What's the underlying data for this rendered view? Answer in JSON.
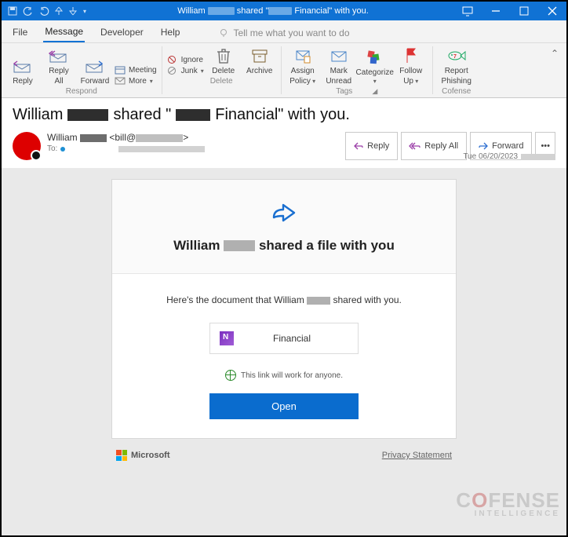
{
  "window": {
    "title_prefix": "William ",
    "title_mid": " shared \"",
    "title_suffix": " Financial\" with you."
  },
  "tabs": {
    "file": "File",
    "message": "Message",
    "developer": "Developer",
    "help": "Help",
    "tell": "Tell me what you want to do"
  },
  "ribbon": {
    "reply": "Reply",
    "reply_all_l1": "Reply",
    "reply_all_l2": "All",
    "forward": "Forward",
    "meeting": "Meeting",
    "more": "More",
    "respond_group": "Respond",
    "ignore": "Ignore",
    "junk": "Junk",
    "delete": "Delete",
    "archive": "Archive",
    "delete_group": "Delete",
    "assign_l1": "Assign",
    "assign_l2": "Policy",
    "mark_l1": "Mark",
    "mark_l2": "Unread",
    "categorize": "Categorize",
    "follow_l1": "Follow",
    "follow_l2": "Up",
    "tags_group": "Tags",
    "report_l1": "Report",
    "report_l2": "Phishing",
    "cofense_group": "Cofense"
  },
  "subject": {
    "p1": "William ",
    "p2": " shared \"",
    "p3": " Financial\" with you."
  },
  "sender": {
    "name_prefix": "William ",
    "addr_prefix": " <bill@",
    "addr_suffix": ">",
    "to_label": "To:"
  },
  "actions": {
    "reply": "Reply",
    "reply_all": "Reply All",
    "forward": "Forward"
  },
  "received": "Tue 06/20/2023",
  "body": {
    "share_p1": "William ",
    "share_p2": " shared a file with you",
    "doc_p1": "Here's the document that William ",
    "doc_p2": " shared with you.",
    "file_suffix": " Financial",
    "link_info": "This link will work for anyone.",
    "open": "Open",
    "microsoft": "Microsoft",
    "privacy": "Privacy Statement"
  },
  "watermark": {
    "brand_pre": "C",
    "brand_o": "O",
    "brand_post": "FENSE",
    "sub": "INTELLIGENCE"
  }
}
